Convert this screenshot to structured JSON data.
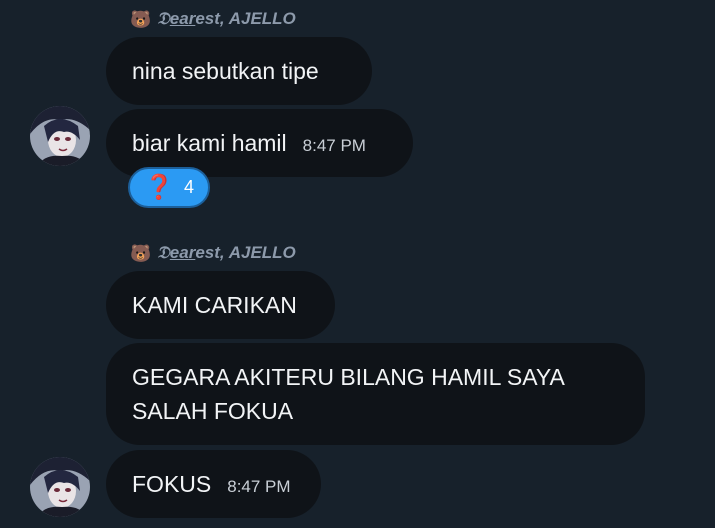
{
  "messages": [
    {
      "sender": {
        "emoji": "🐻",
        "name_prefix": "𝔇",
        "name_underlined": "ear",
        "name_rest": "est",
        "name_suffix": ", AJELLO"
      },
      "bubbles": [
        {
          "text": "nina sebutkan tipe",
          "time": ""
        },
        {
          "text": "biar kami hamil",
          "time": "8:47 PM"
        }
      ],
      "reaction": {
        "emoji": "❓",
        "count": "4"
      }
    },
    {
      "sender": {
        "emoji": "🐻",
        "name_prefix": "𝔇",
        "name_underlined": "ear",
        "name_rest": "est",
        "name_suffix": ", AJELLO"
      },
      "bubbles": [
        {
          "text": "KAMI CARIKAN",
          "time": ""
        },
        {
          "text_line1": "GEGARA AKITERU BILANG HAMIL SAYA",
          "text_line2": "SALAH FOKUA",
          "time": ""
        },
        {
          "text": "FOKUS",
          "time": "8:47 PM"
        }
      ]
    }
  ],
  "colors": {
    "background": "#17212b",
    "bubble": "#0f1318",
    "reaction": "#2b9af3",
    "sender_name": "#8d9aab"
  }
}
